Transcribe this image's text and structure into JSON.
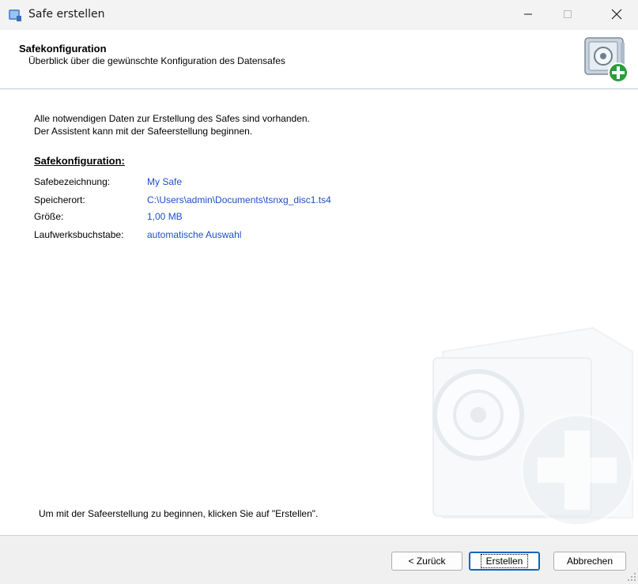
{
  "window": {
    "title": "Safe erstellen"
  },
  "header": {
    "title": "Safekonfiguration",
    "subtitle": "Überblick über die gewünschte Konfiguration des Datensafes"
  },
  "content": {
    "intro_line1": "Alle notwendigen Daten zur Erstellung des Safes sind vorhanden.",
    "intro_line2": "Der Assistent kann mit der Safeerstellung beginnen.",
    "section_title": "Safekonfiguration:",
    "rows": [
      {
        "label": "Safebezeichnung:",
        "value": "My Safe"
      },
      {
        "label": "Speicherort:",
        "value": "C:\\Users\\admin\\Documents\\tsnxg_disc1.ts4"
      },
      {
        "label": "Größe:",
        "value": "1,00 MB"
      },
      {
        "label": "Laufwerksbuchstabe:",
        "value": "automatische Auswahl"
      }
    ],
    "hint": "Um mit der Safeerstellung zu beginnen, klicken Sie auf \"Erstellen\"."
  },
  "footer": {
    "back_label": "< Zurück",
    "create_label": "Erstellen",
    "cancel_label": "Abbrechen"
  },
  "colors": {
    "value_link": "#1f4fc6",
    "titlebar": "#f3f3f3",
    "footer": "#f0f0f0"
  },
  "icons": [
    "app-safe-icon",
    "minimize-icon",
    "maximize-icon",
    "close-icon",
    "safe-add-icon",
    "safe-watermark-icon",
    "resize-grip-icon"
  ]
}
